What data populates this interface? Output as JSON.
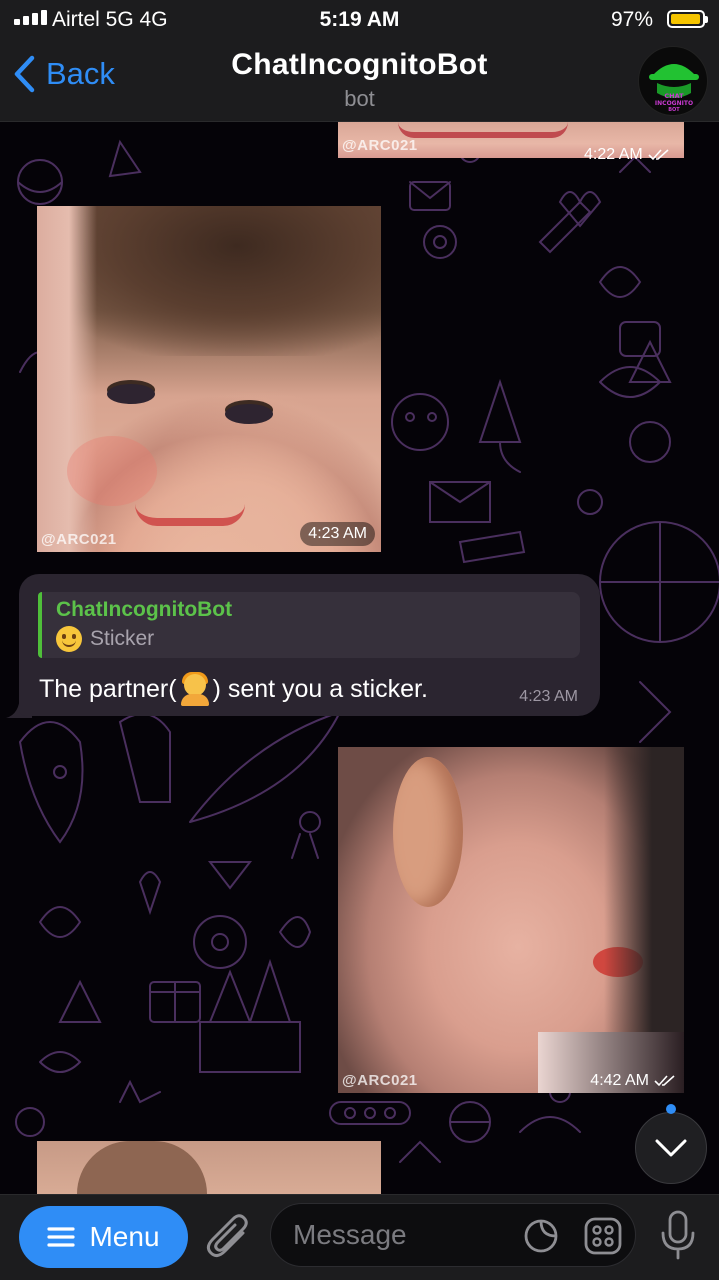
{
  "status_bar": {
    "carrier": "Airtel 5G   4G",
    "time": "5:19 AM",
    "battery_percent": "97%",
    "battery_level": 0.97,
    "battery_color": "#f5c400"
  },
  "header": {
    "back_label": "Back",
    "title": "ChatIncognitoBot",
    "subtitle": "bot",
    "avatar_lines": [
      "CHAT",
      "INCOGNITO",
      "BOT"
    ],
    "avatar_icon": "spy-hat-icon"
  },
  "messages": [
    {
      "type": "photo",
      "side": "right",
      "watermark": "@ARC021",
      "time": "4:22 AM",
      "status": "read"
    },
    {
      "type": "photo",
      "side": "left",
      "watermark": "@ARC021",
      "time": "4:23 AM"
    },
    {
      "type": "text",
      "side": "left",
      "reply": {
        "author": "ChatIncognitoBot",
        "preview": "Sticker",
        "preview_icon": "slightly-smiling-face-emoji"
      },
      "text_before": "The partner(",
      "text_after": ") sent you a sticker.",
      "inline_icon": "person-emoji",
      "time": "4:23 AM"
    },
    {
      "type": "photo",
      "side": "right",
      "watermark": "@ARC021",
      "time": "4:42 AM",
      "status": "read"
    },
    {
      "type": "photo",
      "side": "left",
      "partial": true
    }
  ],
  "input_bar": {
    "menu_label": "Menu",
    "message_placeholder": "Message"
  },
  "colors": {
    "accent": "#2f8df6",
    "bubble": "#2b2530",
    "reply_author": "#5cc24a",
    "header_bg": "#1c1c1e"
  }
}
